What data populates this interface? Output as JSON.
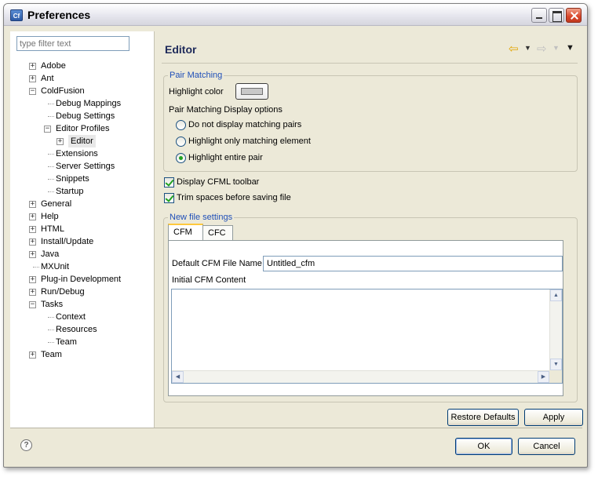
{
  "window": {
    "title": "Preferences",
    "app_icon": "Cf"
  },
  "filter": {
    "placeholder": "type filter text"
  },
  "tree": [
    {
      "label": "Adobe",
      "level": 0,
      "expander": "+"
    },
    {
      "label": "Ant",
      "level": 0,
      "expander": "+"
    },
    {
      "label": "ColdFusion",
      "level": 0,
      "expander": "-"
    },
    {
      "label": "Debug Mappings",
      "level": 1,
      "expander": ""
    },
    {
      "label": "Debug Settings",
      "level": 1,
      "expander": ""
    },
    {
      "label": "Editor Profiles",
      "level": 1,
      "expander": "-"
    },
    {
      "label": "Editor",
      "level": 2,
      "expander": "+",
      "selected": true
    },
    {
      "label": "Extensions",
      "level": 1,
      "expander": ""
    },
    {
      "label": "Server Settings",
      "level": 1,
      "expander": ""
    },
    {
      "label": "Snippets",
      "level": 1,
      "expander": ""
    },
    {
      "label": "Startup",
      "level": 1,
      "expander": ""
    },
    {
      "label": "General",
      "level": 0,
      "expander": "+"
    },
    {
      "label": "Help",
      "level": 0,
      "expander": "+"
    },
    {
      "label": "HTML",
      "level": 0,
      "expander": "+"
    },
    {
      "label": "Install/Update",
      "level": 0,
      "expander": "+"
    },
    {
      "label": "Java",
      "level": 0,
      "expander": "+"
    },
    {
      "label": "MXUnit",
      "level": 0,
      "expander": ""
    },
    {
      "label": "Plug-in Development",
      "level": 0,
      "expander": "+"
    },
    {
      "label": "Run/Debug",
      "level": 0,
      "expander": "+"
    },
    {
      "label": "Tasks",
      "level": 0,
      "expander": "-"
    },
    {
      "label": "Context",
      "level": 1,
      "expander": ""
    },
    {
      "label": "Resources",
      "level": 1,
      "expander": ""
    },
    {
      "label": "Team",
      "level": 1,
      "expander": ""
    },
    {
      "label": "Team",
      "level": 0,
      "expander": "+"
    }
  ],
  "editor": {
    "title": "Editor",
    "pair_matching": {
      "legend": "Pair Matching",
      "highlight_color_label": "Highlight color",
      "highlight_color_value": "#c8c8c8",
      "display_options_label": "Pair Matching Display options",
      "options": [
        {
          "label": "Do not display matching pairs",
          "selected": false
        },
        {
          "label": "Highlight only matching element",
          "selected": false
        },
        {
          "label": "Highlight entire pair",
          "selected": true
        }
      ]
    },
    "display_cfml_toolbar": {
      "label": "Display CFML toolbar",
      "checked": true
    },
    "trim_spaces": {
      "label": "Trim spaces before saving file",
      "checked": true
    },
    "new_file": {
      "legend": "New file settings",
      "tabs": [
        {
          "label": "CFM",
          "active": true
        },
        {
          "label": "CFC",
          "active": false
        }
      ],
      "default_name_label": "Default CFM File Name",
      "default_name_value": "Untitled_cfm",
      "initial_content_label": "Initial CFM Content",
      "initial_content_value": ""
    },
    "restore_defaults": "Restore Defaults",
    "apply": "Apply"
  },
  "footer": {
    "ok": "OK",
    "cancel": "Cancel"
  }
}
